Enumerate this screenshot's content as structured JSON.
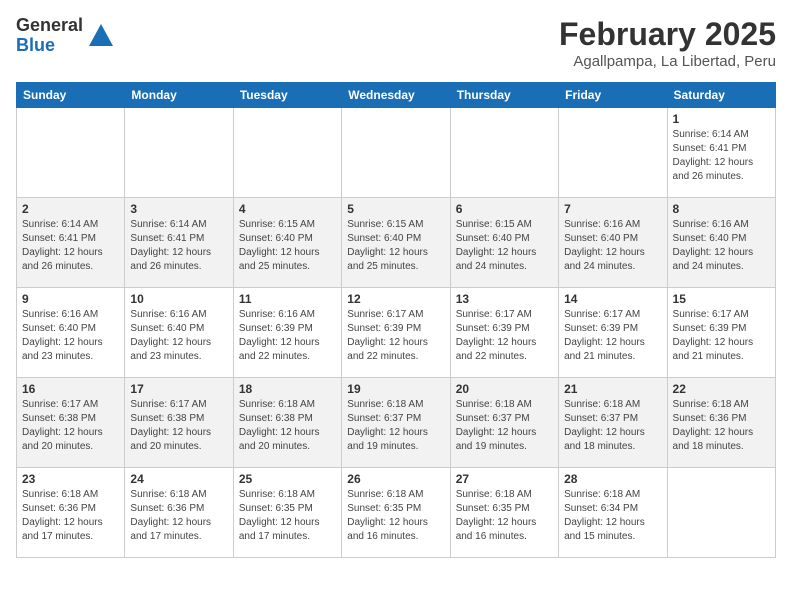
{
  "header": {
    "logo": {
      "general": "General",
      "blue": "Blue"
    },
    "title": "February 2025",
    "location": "Agallpampa, La Libertad, Peru"
  },
  "calendar": {
    "weekdays": [
      "Sunday",
      "Monday",
      "Tuesday",
      "Wednesday",
      "Thursday",
      "Friday",
      "Saturday"
    ],
    "weeks": [
      [
        {
          "day": "",
          "info": ""
        },
        {
          "day": "",
          "info": ""
        },
        {
          "day": "",
          "info": ""
        },
        {
          "day": "",
          "info": ""
        },
        {
          "day": "",
          "info": ""
        },
        {
          "day": "",
          "info": ""
        },
        {
          "day": "1",
          "info": "Sunrise: 6:14 AM\nSunset: 6:41 PM\nDaylight: 12 hours\nand 26 minutes."
        }
      ],
      [
        {
          "day": "2",
          "info": "Sunrise: 6:14 AM\nSunset: 6:41 PM\nDaylight: 12 hours\nand 26 minutes."
        },
        {
          "day": "3",
          "info": "Sunrise: 6:14 AM\nSunset: 6:41 PM\nDaylight: 12 hours\nand 26 minutes."
        },
        {
          "day": "4",
          "info": "Sunrise: 6:15 AM\nSunset: 6:40 PM\nDaylight: 12 hours\nand 25 minutes."
        },
        {
          "day": "5",
          "info": "Sunrise: 6:15 AM\nSunset: 6:40 PM\nDaylight: 12 hours\nand 25 minutes."
        },
        {
          "day": "6",
          "info": "Sunrise: 6:15 AM\nSunset: 6:40 PM\nDaylight: 12 hours\nand 24 minutes."
        },
        {
          "day": "7",
          "info": "Sunrise: 6:16 AM\nSunset: 6:40 PM\nDaylight: 12 hours\nand 24 minutes."
        },
        {
          "day": "8",
          "info": "Sunrise: 6:16 AM\nSunset: 6:40 PM\nDaylight: 12 hours\nand 24 minutes."
        }
      ],
      [
        {
          "day": "9",
          "info": "Sunrise: 6:16 AM\nSunset: 6:40 PM\nDaylight: 12 hours\nand 23 minutes."
        },
        {
          "day": "10",
          "info": "Sunrise: 6:16 AM\nSunset: 6:40 PM\nDaylight: 12 hours\nand 23 minutes."
        },
        {
          "day": "11",
          "info": "Sunrise: 6:16 AM\nSunset: 6:39 PM\nDaylight: 12 hours\nand 22 minutes."
        },
        {
          "day": "12",
          "info": "Sunrise: 6:17 AM\nSunset: 6:39 PM\nDaylight: 12 hours\nand 22 minutes."
        },
        {
          "day": "13",
          "info": "Sunrise: 6:17 AM\nSunset: 6:39 PM\nDaylight: 12 hours\nand 22 minutes."
        },
        {
          "day": "14",
          "info": "Sunrise: 6:17 AM\nSunset: 6:39 PM\nDaylight: 12 hours\nand 21 minutes."
        },
        {
          "day": "15",
          "info": "Sunrise: 6:17 AM\nSunset: 6:39 PM\nDaylight: 12 hours\nand 21 minutes."
        }
      ],
      [
        {
          "day": "16",
          "info": "Sunrise: 6:17 AM\nSunset: 6:38 PM\nDaylight: 12 hours\nand 20 minutes."
        },
        {
          "day": "17",
          "info": "Sunrise: 6:17 AM\nSunset: 6:38 PM\nDaylight: 12 hours\nand 20 minutes."
        },
        {
          "day": "18",
          "info": "Sunrise: 6:18 AM\nSunset: 6:38 PM\nDaylight: 12 hours\nand 20 minutes."
        },
        {
          "day": "19",
          "info": "Sunrise: 6:18 AM\nSunset: 6:37 PM\nDaylight: 12 hours\nand 19 minutes."
        },
        {
          "day": "20",
          "info": "Sunrise: 6:18 AM\nSunset: 6:37 PM\nDaylight: 12 hours\nand 19 minutes."
        },
        {
          "day": "21",
          "info": "Sunrise: 6:18 AM\nSunset: 6:37 PM\nDaylight: 12 hours\nand 18 minutes."
        },
        {
          "day": "22",
          "info": "Sunrise: 6:18 AM\nSunset: 6:36 PM\nDaylight: 12 hours\nand 18 minutes."
        }
      ],
      [
        {
          "day": "23",
          "info": "Sunrise: 6:18 AM\nSunset: 6:36 PM\nDaylight: 12 hours\nand 17 minutes."
        },
        {
          "day": "24",
          "info": "Sunrise: 6:18 AM\nSunset: 6:36 PM\nDaylight: 12 hours\nand 17 minutes."
        },
        {
          "day": "25",
          "info": "Sunrise: 6:18 AM\nSunset: 6:35 PM\nDaylight: 12 hours\nand 17 minutes."
        },
        {
          "day": "26",
          "info": "Sunrise: 6:18 AM\nSunset: 6:35 PM\nDaylight: 12 hours\nand 16 minutes."
        },
        {
          "day": "27",
          "info": "Sunrise: 6:18 AM\nSunset: 6:35 PM\nDaylight: 12 hours\nand 16 minutes."
        },
        {
          "day": "28",
          "info": "Sunrise: 6:18 AM\nSunset: 6:34 PM\nDaylight: 12 hours\nand 15 minutes."
        },
        {
          "day": "",
          "info": ""
        }
      ]
    ]
  }
}
